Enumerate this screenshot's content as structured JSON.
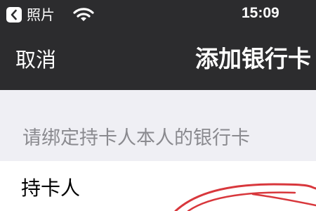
{
  "status_bar": {
    "back_app_label": "照片",
    "time": "15:09"
  },
  "nav": {
    "cancel_label": "取消",
    "title": "添加银行卡"
  },
  "section_header": "请绑定持卡人本人的银行卡",
  "form": {
    "cardholder_label": "持卡人"
  },
  "icons": {
    "back": "chevron-left-icon",
    "wifi": "wifi-icon"
  },
  "colors": {
    "bar_background": "#2c2c2e",
    "page_background": "#efeff4",
    "annotation": "#d8373c"
  }
}
